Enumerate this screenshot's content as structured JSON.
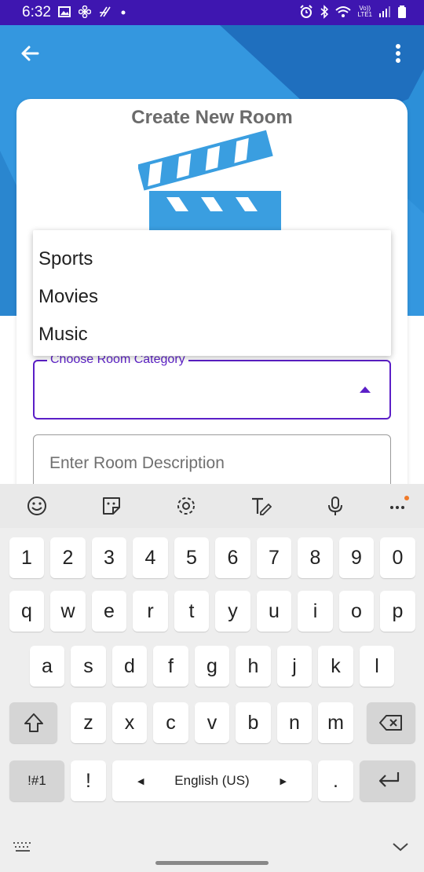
{
  "status_bar": {
    "time": "6:32",
    "left_icons": [
      "image-icon",
      "pinwheel-icon",
      "hash-icon",
      "dot-icon"
    ],
    "right_icons": [
      "alarm-icon",
      "bluetooth-icon",
      "wifi-icon",
      "volte-icon",
      "signal-icon",
      "battery-icon"
    ],
    "volte_text_top": "Vo))",
    "volte_text_bottom": "LTE1"
  },
  "colors": {
    "status_bar": "#3e16b0",
    "header_blue": "#2c8fd8",
    "accent_purple": "#5b1fc7",
    "clapper_blue": "#3a9ee0"
  },
  "appbar": {
    "back_icon": "arrow-left-icon",
    "more_icon": "more-vert-icon"
  },
  "card": {
    "title": "Create New Room"
  },
  "dropdown": {
    "options": [
      "Sports",
      "Movies",
      "Music"
    ]
  },
  "category_field": {
    "label": "Choose Room Category",
    "value": ""
  },
  "description_field": {
    "placeholder": "Enter Room Description"
  },
  "keyboard": {
    "toolbar_icons": [
      "emoji-icon",
      "sticker-icon",
      "settings-icon",
      "text-style-icon",
      "mic-icon",
      "more-horiz-icon"
    ],
    "number_row": [
      "1",
      "2",
      "3",
      "4",
      "5",
      "6",
      "7",
      "8",
      "9",
      "0"
    ],
    "row1": [
      "q",
      "w",
      "e",
      "r",
      "t",
      "y",
      "u",
      "i",
      "o",
      "p"
    ],
    "row2": [
      "a",
      "s",
      "d",
      "f",
      "g",
      "h",
      "j",
      "k",
      "l"
    ],
    "row3": [
      "z",
      "x",
      "c",
      "v",
      "b",
      "n",
      "m"
    ],
    "symbols_key": "!#1",
    "exclaim_key": "!",
    "space_label": "English (US)",
    "period_key": "."
  }
}
